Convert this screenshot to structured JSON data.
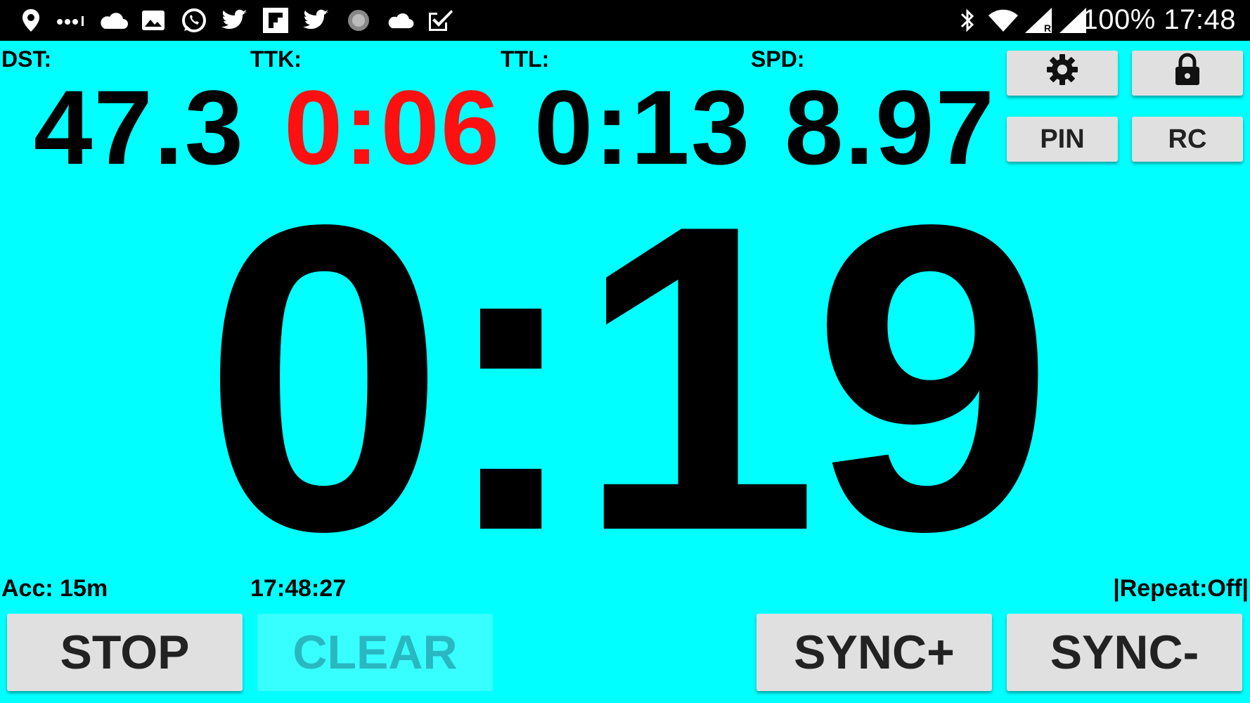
{
  "statusbar": {
    "battery": "100%",
    "time": "17:48",
    "icons": [
      "location-pin-icon",
      "more-dots-icon",
      "cloud-icon",
      "image-icon",
      "whatsapp-icon",
      "twitter-icon",
      "flipboard-icon",
      "twitter-icon",
      "loading-circle-icon",
      "cloud-icon",
      "check-bolt-icon",
      "bluetooth-icon",
      "wifi-icon",
      "signal-roaming-icon",
      "signal-icon"
    ]
  },
  "stats": {
    "dst_label": "DST:",
    "ttk_label": "TTK:",
    "ttl_label": "TTL:",
    "spd_label": "SPD:",
    "dst_value": "47.3",
    "ttk_value": "0:06",
    "ttl_value": "0:13",
    "spd_value": "8.97",
    "ttk_color": "#ff1010"
  },
  "controls": {
    "settings_icon": "gear-icon",
    "lock_icon": "lock-icon",
    "pin_label": "PIN",
    "rc_label": "RC"
  },
  "timer": {
    "value": "0:19"
  },
  "footer": {
    "accuracy": "Acc: 15m",
    "clock": "17:48:27",
    "repeat": "|Repeat:Off|"
  },
  "buttons": {
    "stop": "STOP",
    "clear": "CLEAR",
    "sync_plus": "SYNC+",
    "sync_minus": "SYNC-"
  },
  "colors": {
    "background": "#00ffff",
    "statusbar": "#000000",
    "button": "#e0e0e0"
  }
}
